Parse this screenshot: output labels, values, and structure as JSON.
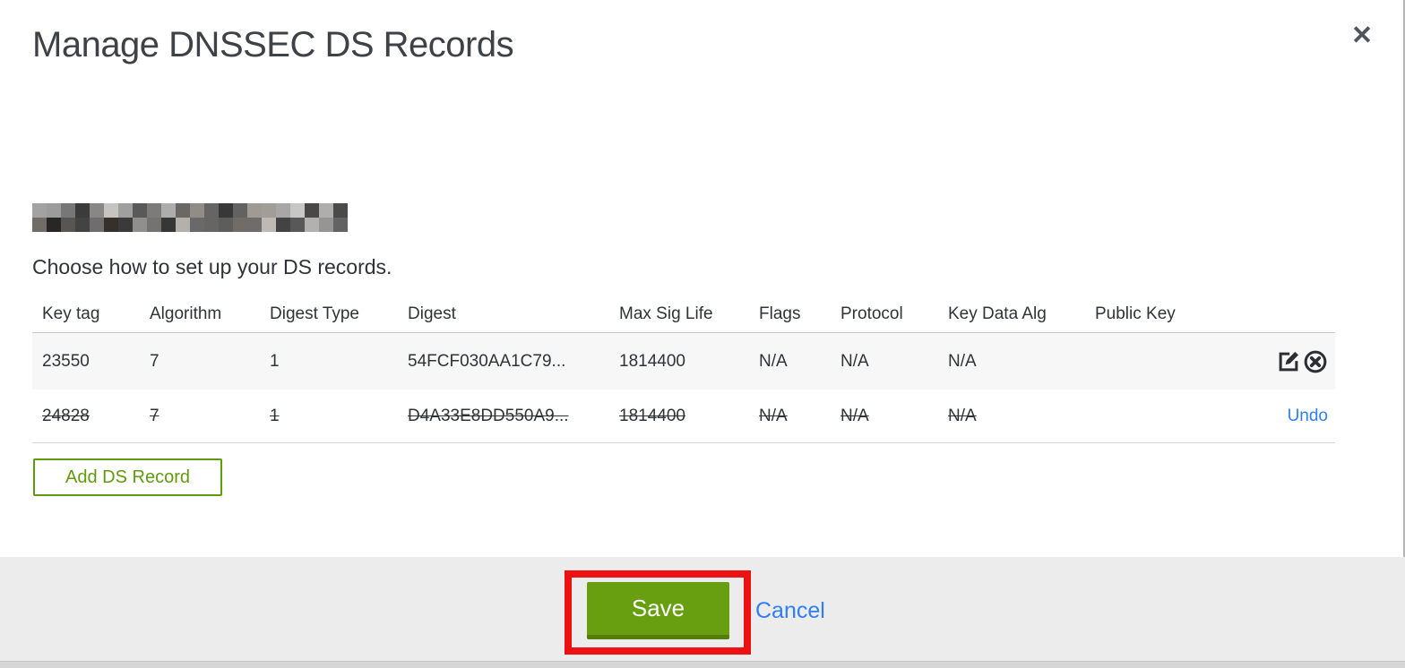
{
  "modal": {
    "title": "Manage DNSSEC DS Records",
    "close_icon": "✕",
    "subtitle": "Choose how to set up your DS records.",
    "buttons": {
      "add": "Add DS Record",
      "save": "Save",
      "cancel": "Cancel"
    }
  },
  "table": {
    "columns": [
      "Key tag",
      "Algorithm",
      "Digest Type",
      "Digest",
      "Max Sig Life",
      "Flags",
      "Protocol",
      "Key Data Alg",
      "Public Key"
    ],
    "rows": [
      {
        "key_tag": "23550",
        "algorithm": "7",
        "digest_type": "1",
        "digest": "54FCF030AA1C79...",
        "max_sig_life": "1814400",
        "flags": "N/A",
        "protocol": "N/A",
        "key_data_alg": "N/A",
        "public_key": "",
        "status": "active"
      },
      {
        "key_tag": "24828",
        "algorithm": "7",
        "digest_type": "1",
        "digest": "D4A33E8DD550A9...",
        "max_sig_life": "1814400",
        "flags": "N/A",
        "protocol": "N/A",
        "key_data_alg": "N/A",
        "public_key": "",
        "status": "marked-for-deletion",
        "undo_label": "Undo"
      }
    ]
  },
  "colors": {
    "accent_green": "#689f11",
    "accent_green_dark": "#557d0a",
    "outline_green": "#5f9b0d",
    "link_blue": "#2f7ef5",
    "annotation_red": "#ee1111",
    "footer_gray": "#ececec",
    "row_stripe": "#f7f7f7"
  }
}
